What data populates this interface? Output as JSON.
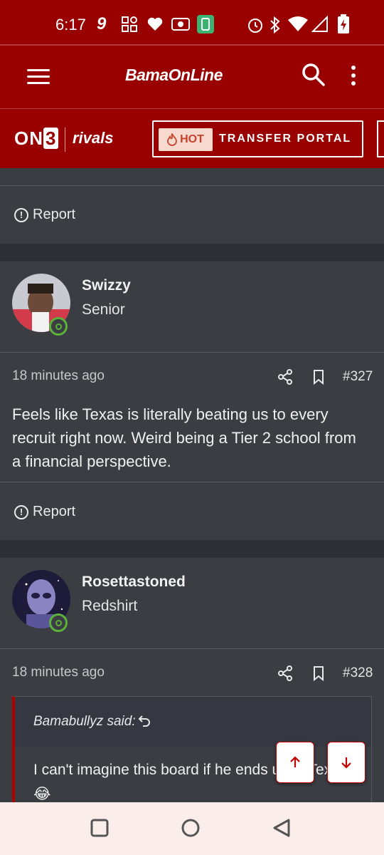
{
  "status_bar": {
    "time": "6:17",
    "left_icons": [
      "9-icon",
      "grid-icon",
      "heart-icon",
      "radio-icon",
      "battery-saver-icon"
    ],
    "right_icons": [
      "alarm-icon",
      "bluetooth-icon",
      "wifi-icon",
      "signal-icon",
      "battery-charging-icon"
    ]
  },
  "app_bar": {
    "logo_text": "BamaOnLine",
    "menu_icon": "hamburger-icon",
    "search_icon": "search-icon",
    "more_icon": "kebab-icon"
  },
  "brand_bar": {
    "on3_prefix": "ON",
    "on3_suffix": "3",
    "rivals": "rivals",
    "hot_label": "HOT",
    "portal_label": "TRANSFER PORTAL"
  },
  "posts": [
    {
      "report_label": "Report"
    },
    {
      "username": "Swizzy",
      "rank": "Senior",
      "time_ago": "18 minutes ago",
      "post_number": "#327",
      "body": "Feels like Texas is literally beating us to every recruit right now. Weird being a Tier 2 school from a financial perspective.",
      "report_label": "Report"
    },
    {
      "username": "Rosettastoned",
      "rank": "Redshirt",
      "time_ago": "18 minutes ago",
      "post_number": "#328",
      "quote": {
        "author": "Bamabullyz said:",
        "text": "I can't imagine this board if he ends up in Texas 😂"
      }
    }
  ],
  "colors": {
    "brand_red": "#990000",
    "background": "#3a3d42",
    "online_green": "#5bb13b"
  }
}
